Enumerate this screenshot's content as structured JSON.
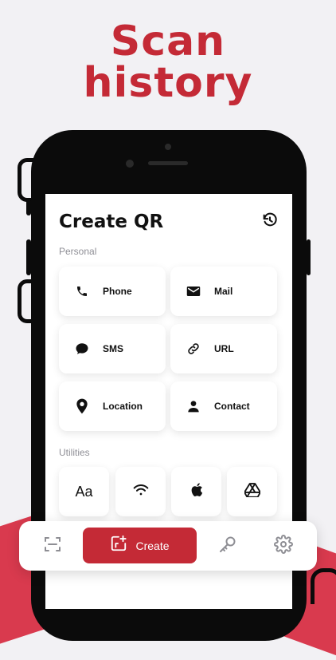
{
  "headline": {
    "line1": "Scan",
    "line2": "history"
  },
  "screen": {
    "title": "Create QR",
    "history_icon": "history-icon",
    "personal_label": "Personal",
    "utilities_label": "Utilities",
    "personal_items": [
      {
        "label": "Phone",
        "icon": "phone-icon"
      },
      {
        "label": "Mail",
        "icon": "mail-icon"
      },
      {
        "label": "SMS",
        "icon": "sms-icon"
      },
      {
        "label": "URL",
        "icon": "link-icon"
      },
      {
        "label": "Location",
        "icon": "location-icon"
      },
      {
        "label": "Contact",
        "icon": "contact-icon"
      }
    ],
    "utility_items": [
      {
        "label": "Aa",
        "icon": "text-icon"
      },
      {
        "icon": "wifi-icon"
      },
      {
        "icon": "apple-icon"
      },
      {
        "icon": "drive-icon"
      }
    ]
  },
  "tabbar": {
    "scan_icon": "scan-icon",
    "create_label": "Create",
    "create_icon": "add-qr-icon",
    "key_icon": "key-icon",
    "settings_icon": "gear-icon"
  },
  "colors": {
    "accent": "#c42a36",
    "background": "#f2f1f4",
    "phone": "#0b0b0b"
  }
}
